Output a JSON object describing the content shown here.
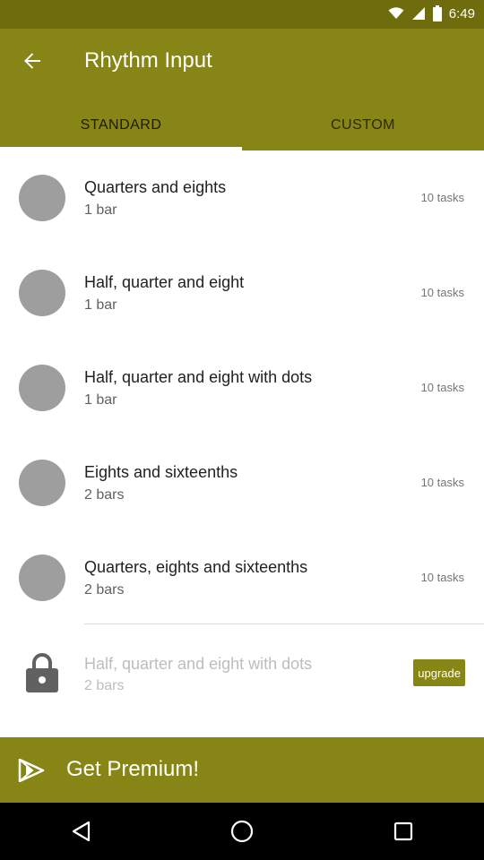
{
  "status_bar": {
    "time": "6:49"
  },
  "app_bar": {
    "title": "Rhythm Input"
  },
  "tabs": [
    {
      "label": "STANDARD",
      "active": true
    },
    {
      "label": "CUSTOM",
      "active": false
    }
  ],
  "exercises": [
    {
      "title": "Quarters and eights",
      "subtitle": "1 bar",
      "count": "10 tasks"
    },
    {
      "title": "Half, quarter and eight",
      "subtitle": "1 bar",
      "count": "10 tasks"
    },
    {
      "title": "Half, quarter and eight with dots",
      "subtitle": "1 bar",
      "count": "10 tasks"
    },
    {
      "title": "Eights and sixteenths",
      "subtitle": "2 bars",
      "count": "10 tasks"
    },
    {
      "title": "Quarters, eights and sixteenths",
      "subtitle": "2 bars",
      "count": "10 tasks"
    }
  ],
  "locked_exercise": {
    "title": "Half, quarter and eight with dots",
    "subtitle": "2 bars",
    "button_label": "upgrade"
  },
  "premium_banner": {
    "label": "Get Premium!"
  },
  "colors": {
    "accent": "#878515",
    "status_bar": "#6e6c0c"
  }
}
